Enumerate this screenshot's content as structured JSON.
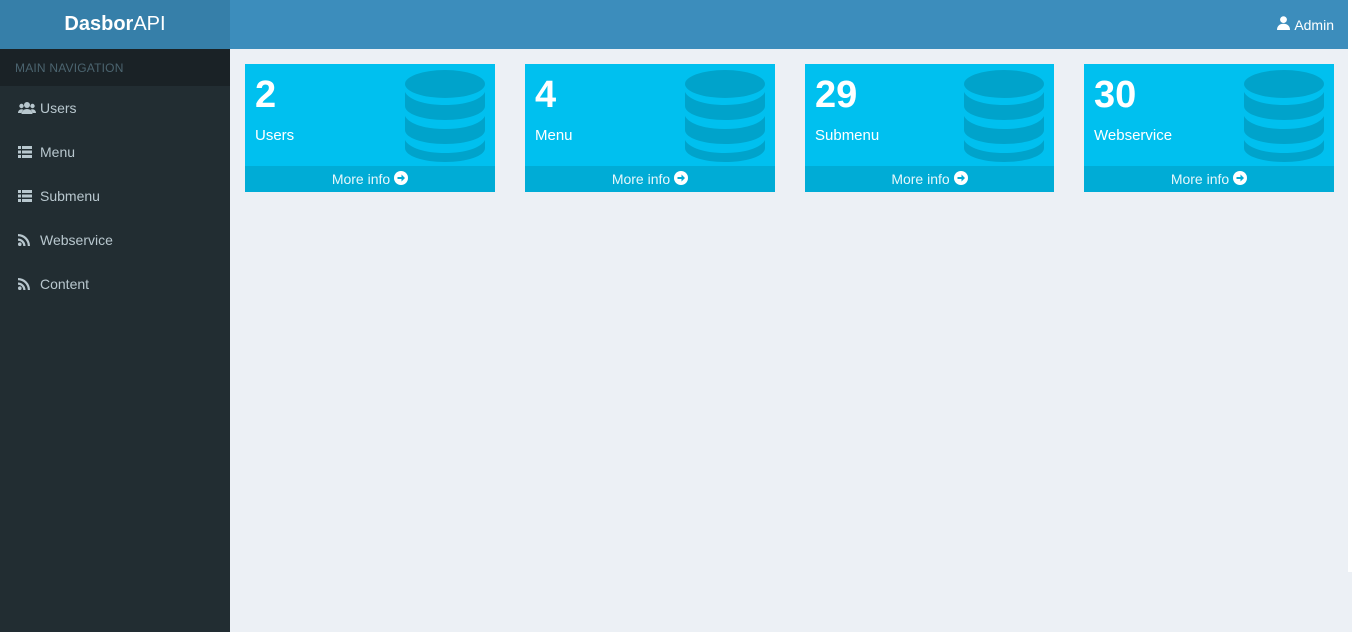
{
  "app": {
    "logo_bold": "Dasbor",
    "logo_light": "API",
    "user": "Admin"
  },
  "sidebar": {
    "header": "MAIN NAVIGATION",
    "items": [
      {
        "label": "Users",
        "icon": "users-icon"
      },
      {
        "label": "Menu",
        "icon": "list-icon"
      },
      {
        "label": "Submenu",
        "icon": "list-icon"
      },
      {
        "label": "Webservice",
        "icon": "rss-icon"
      },
      {
        "label": "Content",
        "icon": "rss-icon"
      }
    ]
  },
  "boxes": [
    {
      "count": "2",
      "label": "Users",
      "link": "More info",
      "icon": "database-icon"
    },
    {
      "count": "4",
      "label": "Menu",
      "link": "More info",
      "icon": "database-icon"
    },
    {
      "count": "29",
      "label": "Submenu",
      "link": "More info",
      "icon": "database-icon"
    },
    {
      "count": "30",
      "label": "Webservice",
      "link": "More info",
      "icon": "database-icon"
    }
  ],
  "colors": {
    "sidebar_bg": "#222d32",
    "header_bg": "#3c8dbc",
    "logo_bg": "#367fa9",
    "box_bg": "#00c0ef",
    "box_footer_bg": "#00acd6",
    "content_bg": "#ecf0f5"
  }
}
